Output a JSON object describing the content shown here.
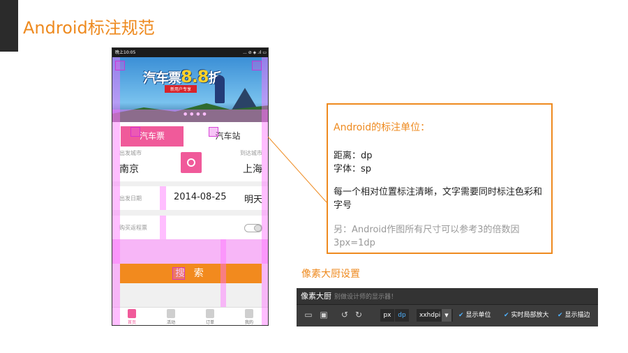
{
  "slide": {
    "title": "Android标注规范"
  },
  "phone": {
    "status": {
      "carrier": "晚上10:05",
      "icons": "... ⊘ ◈ .ıl ▭"
    },
    "banner": {
      "title_prefix": "汽车票",
      "title_num": "8.8",
      "title_suffix": "折",
      "subtitle": "新用户专享"
    },
    "tabs": [
      {
        "label": "汽车票",
        "active": true
      },
      {
        "label": "汽车站",
        "active": false
      }
    ],
    "from": {
      "label": "出发城市",
      "value": "南京"
    },
    "to": {
      "label": "到达城市",
      "value": "上海"
    },
    "date": {
      "label": "出发日期",
      "value": "2014-08-25",
      "weekday": "明天"
    },
    "return_trip": {
      "label": "购买返程票",
      "enabled": false
    },
    "search_label": "搜 索",
    "nav": [
      {
        "label": "首页",
        "active": true
      },
      {
        "label": "活动",
        "active": false
      },
      {
        "label": "订单",
        "active": false
      },
      {
        "label": "我的",
        "active": false
      }
    ]
  },
  "info": {
    "title": "Android的标注单位：",
    "distance": "距离：dp",
    "font": "字体：sp",
    "rule": "每一个相对位置标注清晰，文字需要同时标注色彩和字号",
    "note": "另：Android作图所有尺寸可以参考3的倍数因3px=1dp"
  },
  "toolbar": {
    "section_title": "像素大厨设置",
    "app_name": "像素大厨",
    "app_tagline": "别做设计师的显示器！",
    "units": [
      "px",
      "dp"
    ],
    "active_unit": "dp",
    "density": "xxhdpi",
    "options": [
      "显示单位",
      "实时局部放大",
      "显示描边"
    ]
  },
  "colors": {
    "accent": "#ee8a1f",
    "pink": "#f05a9a",
    "toolbar_bg": "#3c3c3c"
  }
}
